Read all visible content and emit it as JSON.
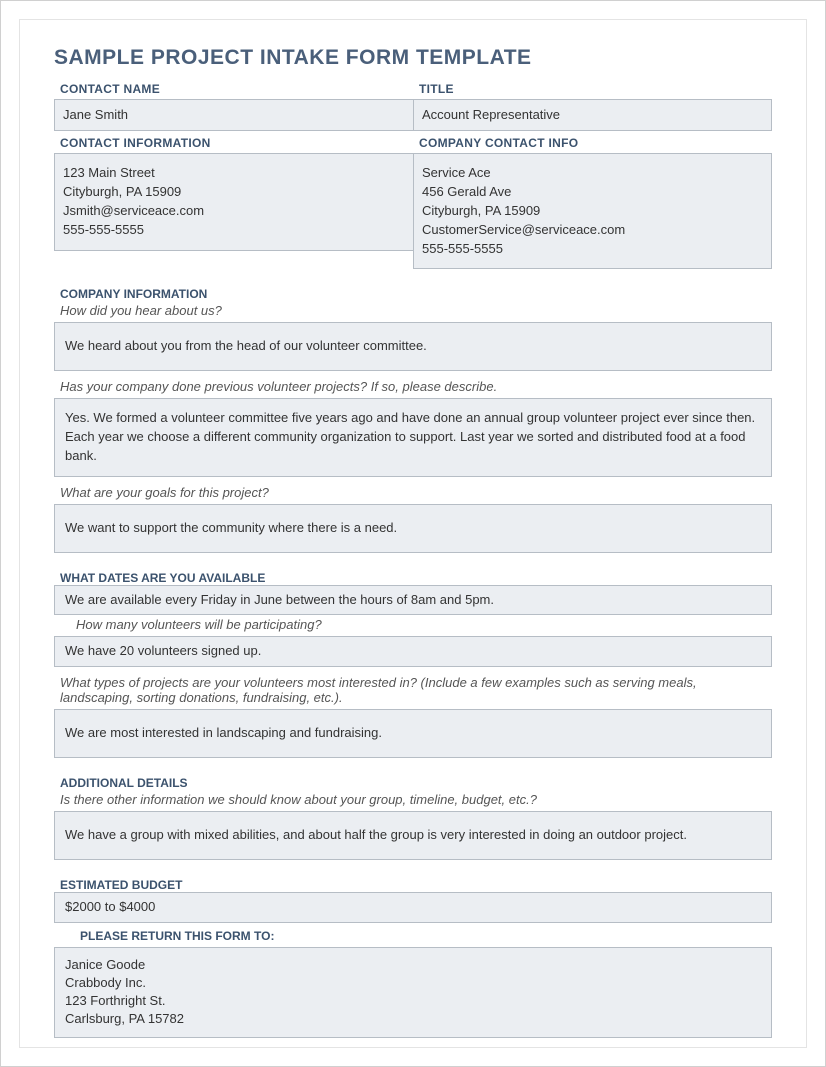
{
  "title": "SAMPLE PROJECT INTAKE FORM TEMPLATE",
  "labels": {
    "contact_name": "CONTACT NAME",
    "title": "TITLE",
    "contact_info": "CONTACT INFORMATION",
    "company_contact": "COMPANY CONTACT INFO",
    "company_info": "COMPANY INFORMATION",
    "dates": "WHAT DATES ARE YOU AVAILABLE",
    "additional": "ADDITIONAL DETAILS",
    "budget": "ESTIMATED BUDGET",
    "return_to": "PLEASE RETURN THIS FORM TO:"
  },
  "prompts": {
    "heard": "How did you hear about us?",
    "previous": "Has your company done previous volunteer projects? If so, please describe.",
    "goals": "What are your goals for this project?",
    "volunteers": "How many volunteers will be participating?",
    "types": "What types of projects are your volunteers most interested in? (Include a few examples such as serving meals, landscaping, sorting donations, fundraising, etc.).",
    "other": "Is there other information we should know about your group, timeline, budget, etc.?"
  },
  "contact": {
    "name": "Jane Smith",
    "title": "Account Representative",
    "info": "123 Main Street\nCityburgh, PA 15909\nJsmith@serviceace.com\n555-555-5555",
    "company": "Service Ace\n456 Gerald Ave\nCityburgh, PA 15909\nCustomerService@serviceace.com\n555-555-5555"
  },
  "answers": {
    "heard": "We heard about you from the head of our volunteer committee.",
    "previous": "Yes. We formed a volunteer committee five years ago and have done an annual group volunteer project ever since then. Each year we choose a different community organization to support. Last year we sorted and distributed food at a food bank.",
    "goals": "We want to support the community where there is a need.",
    "dates": "We are available every Friday in June between the hours of 8am and 5pm.",
    "volunteers": "We have 20 volunteers signed up.",
    "types": "We are most interested in landscaping and fundraising.",
    "other": "We have a group with mixed abilities, and about half the group is very interested in doing an outdoor project.",
    "budget": "$2000 to $4000"
  },
  "return_to": "Janice Goode\nCrabbody Inc.\n123 Forthright St.\nCarlsburg, PA 15782"
}
